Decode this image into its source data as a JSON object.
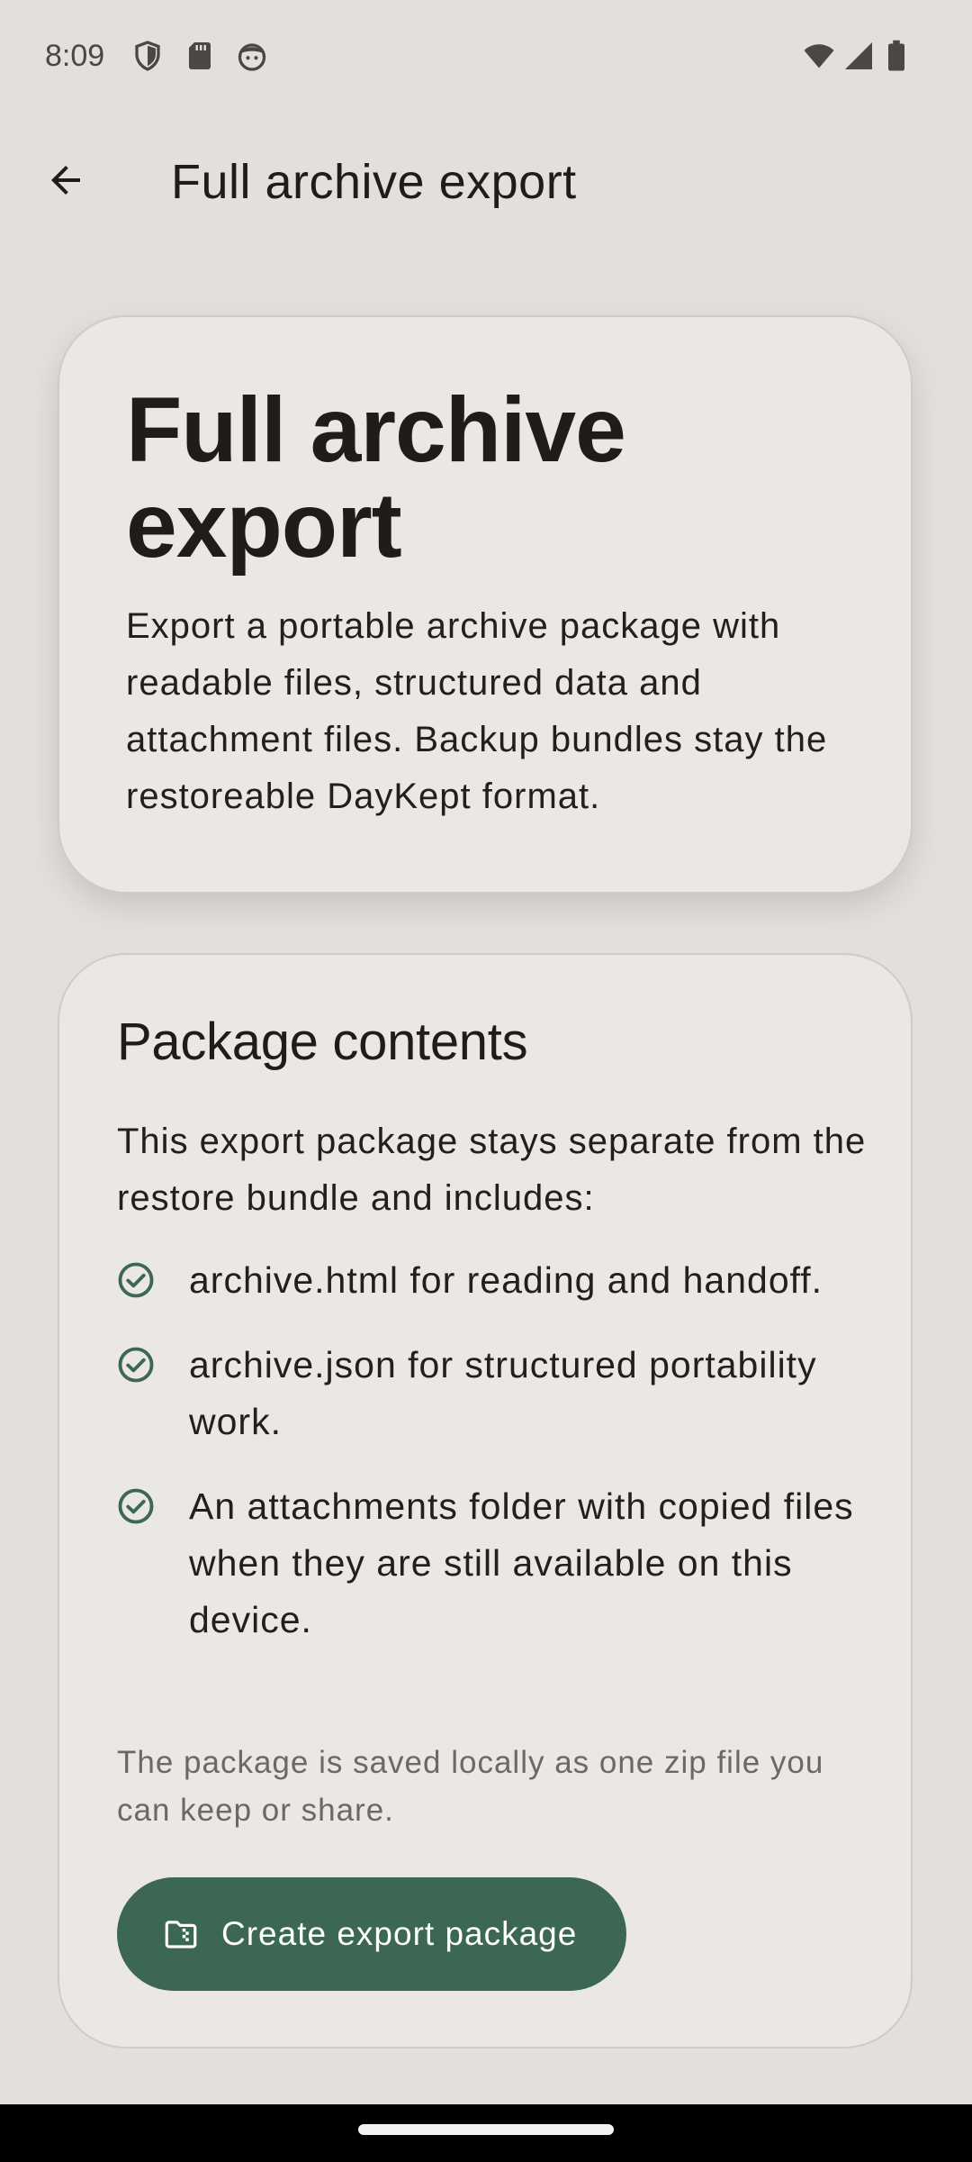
{
  "status_bar": {
    "time": "8:09",
    "left_icons": [
      "shield-icon",
      "sd-card-icon",
      "face-icon"
    ],
    "right_icons": [
      "wifi-icon",
      "signal-icon",
      "battery-icon"
    ]
  },
  "app_bar": {
    "back_icon": "arrow-left-icon",
    "title": "Full archive export"
  },
  "hero": {
    "title": "Full archive export",
    "description": "Export a portable archive package with readable files, structured data and attachment files. Backup bundles stay the restoreable DayKept format."
  },
  "package_contents": {
    "title": "Package contents",
    "intro": "This export package stays separate from the restore bundle and includes:",
    "items": [
      {
        "icon": "check-circle-icon",
        "text": "archive.html for reading and handoff."
      },
      {
        "icon": "check-circle-icon",
        "text": "archive.json for structured portability work."
      },
      {
        "icon": "check-circle-icon",
        "text": "An attachments folder with copied files when they are still available on this device."
      }
    ],
    "footnote": "The package is saved locally as one zip file you can keep or share.",
    "button": {
      "icon": "folder-zip-icon",
      "label": "Create export package"
    }
  },
  "colors": {
    "background": "#e3e0db",
    "card": "#ebe8e4",
    "accent": "#3b6753",
    "text": "#1f1d1a",
    "muted_text": "#6c6965"
  }
}
